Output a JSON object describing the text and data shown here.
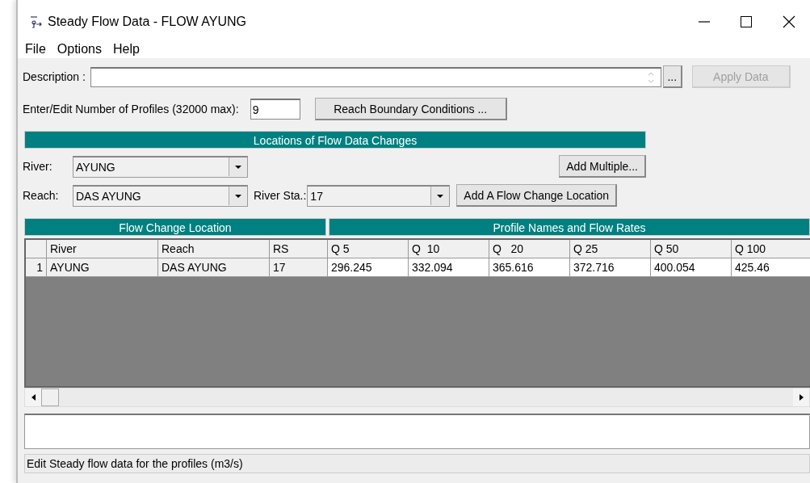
{
  "window": {
    "title": "Steady Flow Data - FLOW AYUNG"
  },
  "menu": [
    {
      "label": "File"
    },
    {
      "label": "Options"
    },
    {
      "label": "Help"
    }
  ],
  "description": {
    "label": "Description :",
    "browse_button": "...",
    "apply_button": {
      "label": "Apply Data",
      "disabled": true
    }
  },
  "profiles": {
    "label": "Enter/Edit Number of Profiles (32000 max):",
    "value": "9",
    "boundary_button": "Reach Boundary Conditions ..."
  },
  "locations": {
    "title": "Locations of Flow Data Changes",
    "river": {
      "label": "River:",
      "value": "AYUNG"
    },
    "reach": {
      "label": "Reach:",
      "value": "DAS AYUNG"
    },
    "river_station": {
      "label": "River Sta.:",
      "value": "17"
    },
    "add_multiple_button": "Add Multiple...",
    "add_location_button": "Add A Flow Change Location"
  },
  "table": {
    "group_headers": [
      "Flow Change Location",
      "Profile Names and Flow Rates"
    ],
    "columns": [
      "River",
      "Reach",
      "RS",
      "Q 5",
      "Q  10",
      "Q   20",
      "Q 25",
      "Q 50",
      "Q 100"
    ],
    "rows": [
      {
        "number": "1",
        "cells": [
          "AYUNG",
          "DAS AYUNG",
          "17",
          "296.245",
          "332.094",
          "365.616",
          "372.716",
          "400.054",
          "425.46"
        ]
      }
    ]
  },
  "status_bar": "Edit Steady flow data for the profiles (m3/s)"
}
